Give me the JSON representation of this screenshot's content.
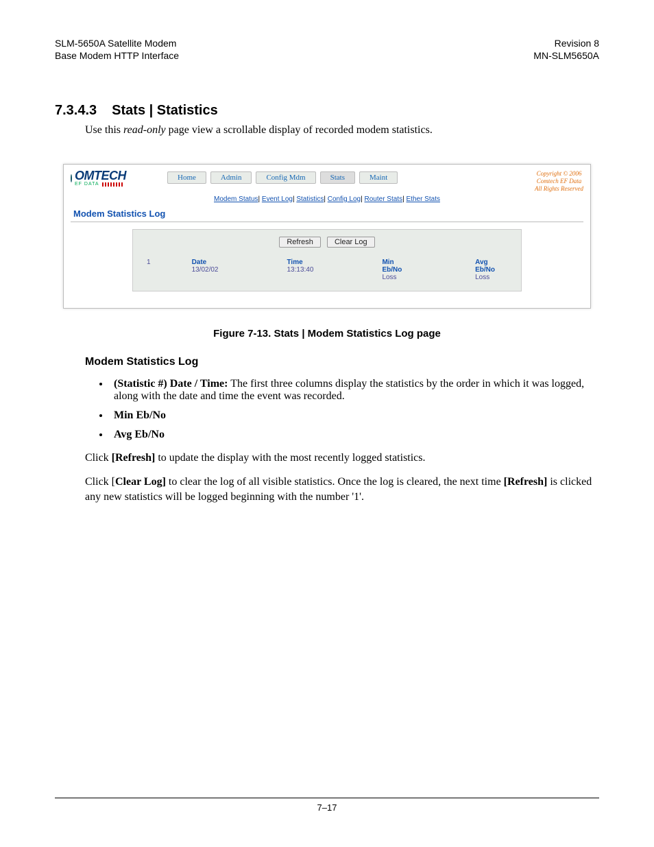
{
  "header": {
    "left1": "SLM-5650A Satellite Modem",
    "left2": "Base Modem HTTP Interface",
    "right1": "Revision 8",
    "right2": "MN-SLM5650A"
  },
  "section": {
    "number": "7.3.4.3",
    "title": "Stats | Statistics",
    "intro_pre": "Use this ",
    "intro_em": "read-only",
    "intro_post": " page view a scrollable display of recorded modem statistics."
  },
  "screenshot": {
    "logo": {
      "brand": "OMTECH",
      "sub": "EF DATA"
    },
    "tabs": [
      "Home",
      "Admin",
      "Config Mdm",
      "Stats",
      "Maint"
    ],
    "active_tab_index": 3,
    "subnav": [
      "Modem Status",
      "Event Log",
      "Statistics",
      "Config Log",
      "Router Stats",
      "Ether Stats"
    ],
    "panel_title": "Modem Statistics Log",
    "buttons": {
      "refresh": "Refresh",
      "clear": "Clear Log"
    },
    "columns": [
      {
        "hdr": "",
        "val": "1"
      },
      {
        "hdr": "Date",
        "val": "13/02/02"
      },
      {
        "hdr": "Time",
        "val": "13:13:40"
      },
      {
        "hdr": "Min Eb/No",
        "val": "Loss"
      },
      {
        "hdr": "Avg Eb/No",
        "val": "Loss"
      }
    ],
    "copyright": {
      "l1": "Copyright © 2006",
      "l2": "Comtech EF Data",
      "l3": "All Rights Reserved"
    }
  },
  "figure_caption": "Figure 7-13. Stats | Modem Statistics Log page",
  "subhead": "Modem Statistics Log",
  "bullets": {
    "b1_strong": "(Statistic #) Date / Time:",
    "b1_rest": " The first three columns display the statistics by the order in which it was logged, along with the date and time the event was recorded.",
    "b2": "Min Eb/No",
    "b3": "Avg Eb/No"
  },
  "paras": {
    "p1_pre": "Click ",
    "p1_btn": "[Refresh]",
    "p1_post": " to update the display with the most recently logged statistics.",
    "p2_pre1": "Click [",
    "p2_btn1": "Clear Log]",
    "p2_mid": " to clear the log of all visible statistics. Once the log is cleared, the next time ",
    "p2_btn2": "[Refresh]",
    "p2_post": " is clicked any new statistics will be logged beginning with the number '1'."
  },
  "footer": "7–17"
}
